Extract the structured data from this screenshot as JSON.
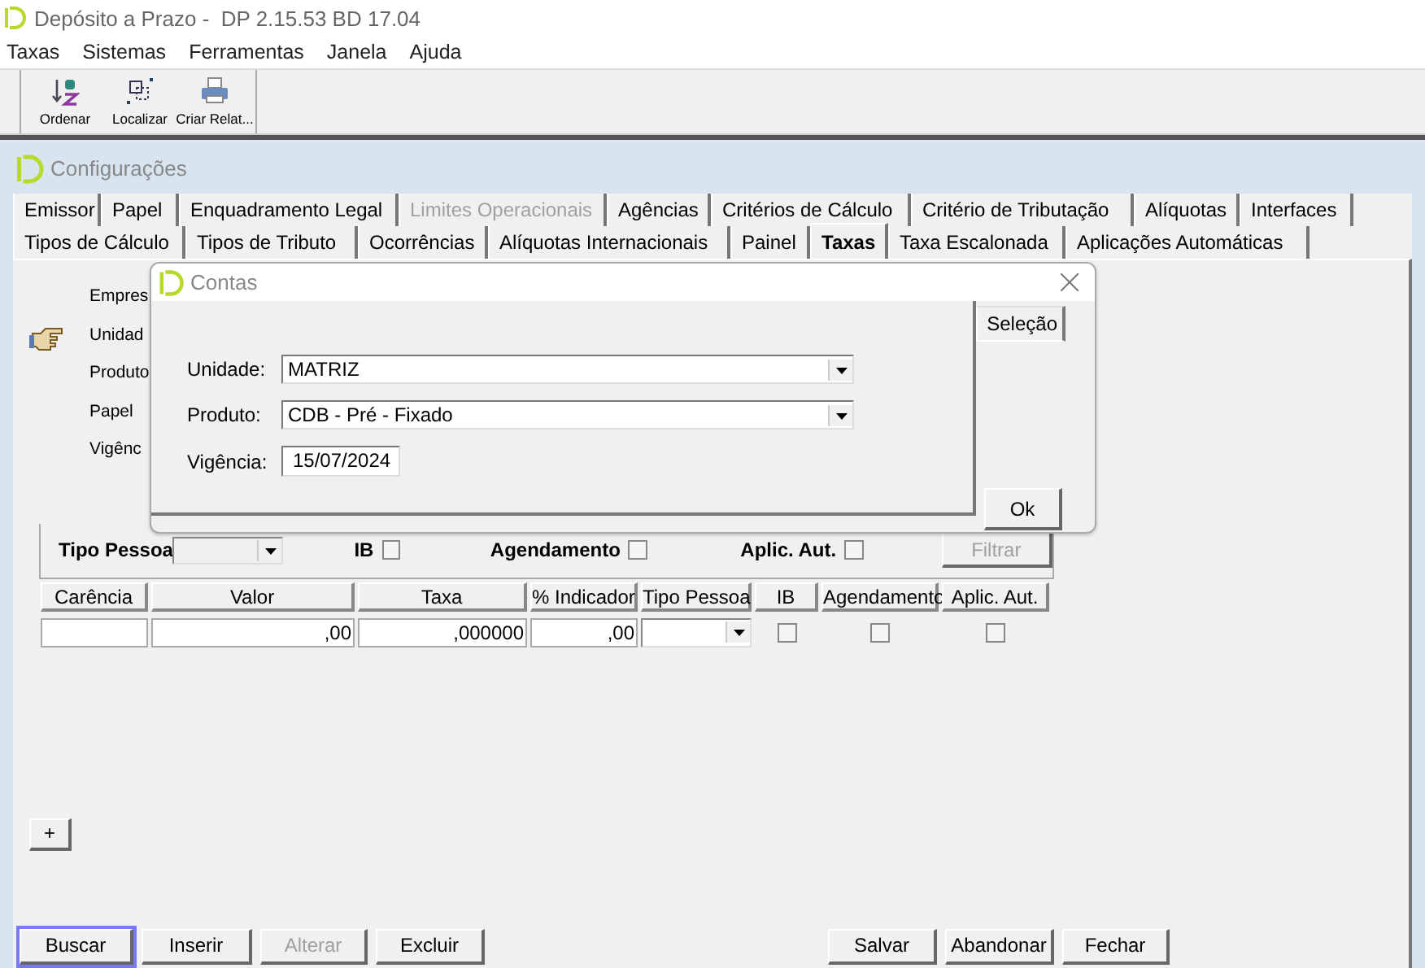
{
  "window": {
    "title": "Depósito a Prazo -  DP 2.15.53 BD 17.04"
  },
  "menu": [
    "Taxas",
    "Sistemas",
    "Ferramentas",
    "Janela",
    "Ajuda"
  ],
  "toolbar": [
    {
      "label": "Ordenar"
    },
    {
      "label": "Localizar"
    },
    {
      "label": "Criar Relat..."
    }
  ],
  "child_window": {
    "title": "Configurações"
  },
  "tab_rows": [
    [
      {
        "label": "Emissor",
        "selected": false,
        "disabled": false
      },
      {
        "label": "Papel",
        "selected": false,
        "disabled": false
      },
      {
        "label": "Enquadramento Legal",
        "selected": false,
        "disabled": false
      },
      {
        "label": "Limites Operacionais",
        "selected": false,
        "disabled": true
      },
      {
        "label": "Agências",
        "selected": false,
        "disabled": false
      },
      {
        "label": "Critérios de Cálculo",
        "selected": false,
        "disabled": false
      },
      {
        "label": "Critério de Tributação",
        "selected": false,
        "disabled": false
      },
      {
        "label": "Alíquotas",
        "selected": false,
        "disabled": false
      },
      {
        "label": "Interfaces",
        "selected": false,
        "disabled": false
      }
    ],
    [
      {
        "label": "Tipos de Cálculo",
        "selected": false,
        "disabled": false
      },
      {
        "label": "Tipos de Tributo",
        "selected": false,
        "disabled": false
      },
      {
        "label": "Ocorrências",
        "selected": false,
        "disabled": false
      },
      {
        "label": "Alíquotas Internacionais",
        "selected": false,
        "disabled": false
      },
      {
        "label": "Painel",
        "selected": false,
        "disabled": false
      },
      {
        "label": "Taxas",
        "selected": true,
        "disabled": false
      },
      {
        "label": "Taxa Escalonada",
        "selected": false,
        "disabled": false
      },
      {
        "label": "Aplicações Automáticas",
        "selected": false,
        "disabled": false
      }
    ]
  ],
  "form_labels": [
    "Empres",
    "Unidad",
    "Produto",
    "Papel",
    "Vigênc"
  ],
  "filter": {
    "label": "Tipo Pessoa",
    "checks": [
      {
        "label": "IB",
        "checked": false
      },
      {
        "label": "Agendamento",
        "checked": false
      },
      {
        "label": "Aplic. Aut.",
        "checked": false
      }
    ],
    "button": {
      "label": "Filtrar",
      "disabled": true
    }
  },
  "grid": {
    "columns": [
      "Carência",
      "Valor",
      "Taxa",
      "% Indicador",
      "Tipo Pessoa",
      "IB",
      "Agendamento",
      "Aplic. Aut."
    ],
    "row": [
      {
        "kind": "text"
      },
      {
        "kind": "text",
        "value": ",00"
      },
      {
        "kind": "text",
        "value": ",000000"
      },
      {
        "kind": "text",
        "value": ",00"
      },
      {
        "kind": "combo"
      },
      {
        "kind": "check",
        "checked": false
      },
      {
        "kind": "check",
        "checked": false
      },
      {
        "kind": "check",
        "checked": false
      }
    ]
  },
  "add_button": "+",
  "buttons_left": [
    {
      "label": "Buscar",
      "disabled": false,
      "focused": true
    },
    {
      "label": "Inserir",
      "disabled": false,
      "focused": false
    },
    {
      "label": "Alterar",
      "disabled": true,
      "focused": false
    },
    {
      "label": "Excluir",
      "disabled": false,
      "focused": false
    }
  ],
  "buttons_right": [
    {
      "label": "Salvar",
      "disabled": false,
      "focused": false
    },
    {
      "label": "Abandonar",
      "disabled": false,
      "focused": false
    },
    {
      "label": "Fechar",
      "disabled": false,
      "focused": false
    }
  ],
  "dialog": {
    "title": "Contas",
    "tab": "Seleção",
    "fields": [
      {
        "label": "Unidade:",
        "value": "MATRIZ",
        "kind": "combo"
      },
      {
        "label": "Produto:",
        "value": "CDB - Pré - Fixado",
        "kind": "combo"
      },
      {
        "label": "Vigência:",
        "value": "15/07/2024",
        "kind": "text"
      }
    ],
    "ok": "Ok"
  }
}
